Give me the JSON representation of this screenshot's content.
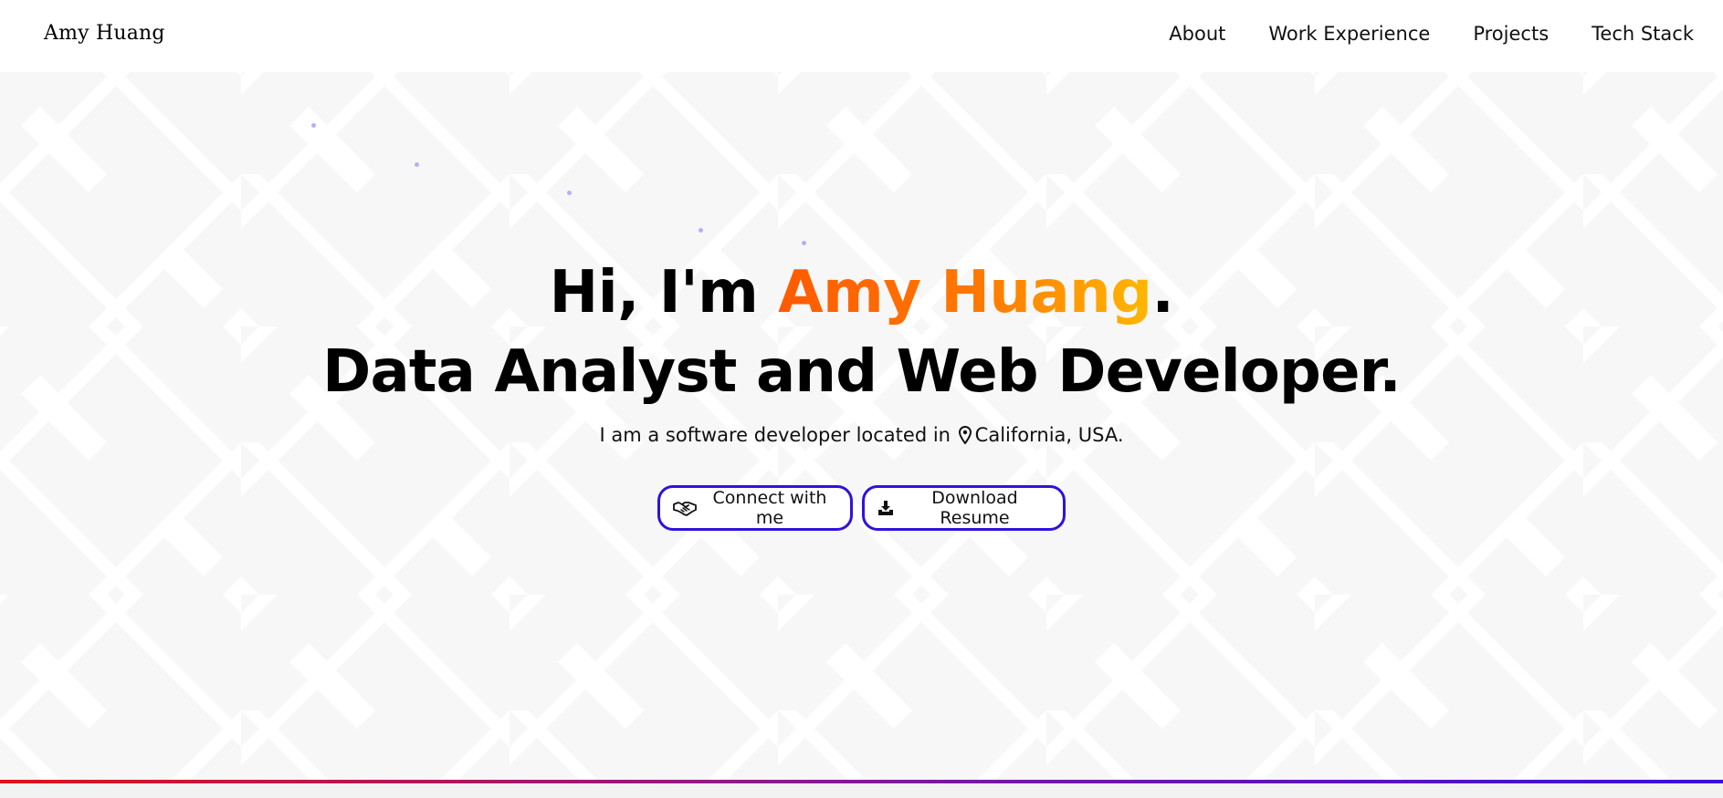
{
  "navbar": {
    "brand": "Amy Huang",
    "links": [
      {
        "label": "About"
      },
      {
        "label": "Work Experience"
      },
      {
        "label": "Projects"
      },
      {
        "label": "Tech Stack"
      }
    ]
  },
  "hero": {
    "greeting_prefix": "Hi, I'm ",
    "name": "Amy Huang",
    "greeting_suffix": ".",
    "role": "Data Analyst and Web Developer.",
    "tagline_prefix": "I am a software developer located in",
    "location": "California, USA.",
    "location_icon": "map-pin-icon",
    "buttons": {
      "connect_label": "Connect with me",
      "connect_icon": "handshake-icon",
      "resume_label": "Download Resume",
      "resume_icon": "download-icon"
    }
  },
  "colors": {
    "accent_border": "#2f12dc",
    "name_gradient_start": "#ff5a00",
    "name_gradient_end": "#ffb800",
    "background_pattern": "#f7f7f7",
    "bottom_bar_start": "#e0131b",
    "bottom_bar_end": "#3a10e0"
  }
}
